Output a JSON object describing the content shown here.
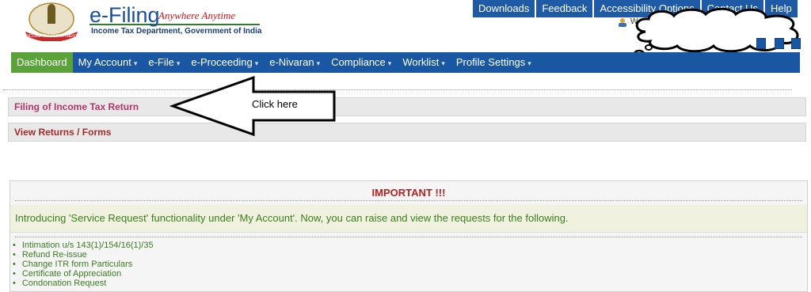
{
  "header": {
    "brand_title": "e-Filing",
    "brand_tagline": "Anywhere Anytime",
    "brand_subtitle": "Income Tax Department, Government of India",
    "top_links": [
      {
        "label": "Downloads"
      },
      {
        "label": "Feedback"
      },
      {
        "label": "Accessibility Options"
      },
      {
        "label": "Contact Us"
      },
      {
        "label": "Help"
      }
    ],
    "welcome_text": "We"
  },
  "nav": {
    "items": [
      {
        "label": "Dashboard",
        "caret": ""
      },
      {
        "label": "My Account",
        "caret": "▾"
      },
      {
        "label": "e-File",
        "caret": "▾"
      },
      {
        "label": "e-Proceeding",
        "caret": "▾"
      },
      {
        "label": "e-Nivaran",
        "caret": "▾"
      },
      {
        "label": "Compliance",
        "caret": "▾"
      },
      {
        "label": "Worklist",
        "caret": "▾"
      },
      {
        "label": "Profile Settings",
        "caret": "▾"
      }
    ]
  },
  "main": {
    "rows": [
      {
        "label": "Filing of Income Tax Return"
      },
      {
        "label": "View Returns / Forms"
      }
    ],
    "annotation": {
      "text": "Click here"
    }
  },
  "important": {
    "title": "IMPORTANT !!!",
    "notice": "Introducing 'Service Request' functionality under 'My Account'. Now, you can raise and view the requests for the following.",
    "items": [
      {
        "label": "Intimation u/s 143(1)/154/16(1)/35"
      },
      {
        "label": "Refund Re-issue"
      },
      {
        "label": "Change ITR form Particulars"
      },
      {
        "label": "Certificate of Appreciation"
      },
      {
        "label": "Condonation Request"
      }
    ]
  },
  "colors": {
    "nav_bg": "#1a57a3",
    "nav_active": "#5aa33a",
    "row1_text": "#b5346d",
    "row2_text": "#a52a2a",
    "important_title": "#b22222",
    "notice_text": "#3b7d1f"
  }
}
